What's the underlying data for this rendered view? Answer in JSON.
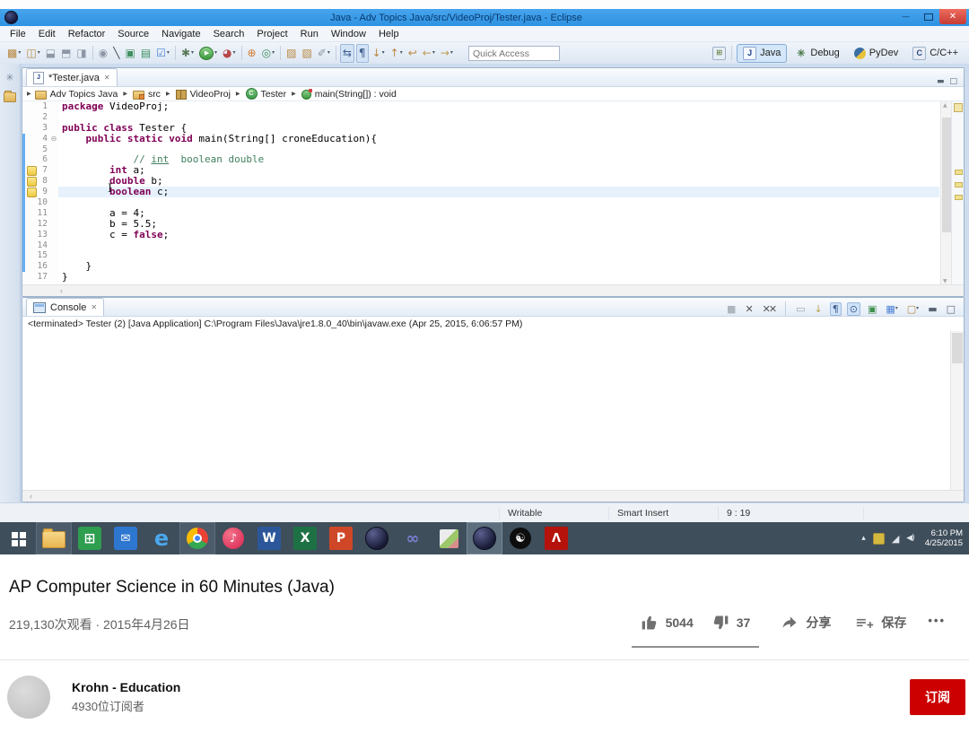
{
  "eclipse": {
    "window_title": "Java - Adv Topics Java/src/VideoProj/Tester.java - Eclipse",
    "menus": [
      "File",
      "Edit",
      "Refactor",
      "Source",
      "Navigate",
      "Search",
      "Project",
      "Run",
      "Window",
      "Help"
    ],
    "quick_access_placeholder": "Quick Access",
    "toolbar_icons": [
      {
        "name": "new-icon",
        "dropdown": true
      },
      {
        "name": "save-all-icon",
        "dropdown": true
      },
      {
        "name": "save-icon"
      },
      {
        "name": "print-icon"
      },
      {
        "name": "export-icon"
      },
      {
        "sep": true
      },
      {
        "name": "search-icon"
      },
      {
        "name": "annotation-icon"
      },
      {
        "name": "new-package-icon"
      },
      {
        "name": "new-class-icon"
      },
      {
        "name": "task-icon",
        "dropdown": true
      },
      {
        "sep": true
      },
      {
        "name": "debug-icon",
        "dropdown": true
      },
      {
        "name": "run-icon",
        "dropdown": true
      },
      {
        "name": "coverage-icon",
        "dropdown": true
      },
      {
        "sep": true
      },
      {
        "name": "junit-icon"
      },
      {
        "name": "gc-icon",
        "dropdown": true
      },
      {
        "sep": true
      },
      {
        "name": "open-type-icon"
      },
      {
        "name": "open-resource-icon"
      },
      {
        "name": "mark-occurrences-icon",
        "dropdown": true
      },
      {
        "sep": true
      },
      {
        "name": "link-editor-icon",
        "boxed": true
      },
      {
        "name": "show-whitespace-icon",
        "boxed": true
      },
      {
        "name": "next-annotation-icon",
        "dropdown": true
      },
      {
        "name": "prev-annotation-icon",
        "dropdown": true
      },
      {
        "name": "last-edit-icon"
      },
      {
        "name": "back-icon",
        "dropdown": true
      },
      {
        "name": "forward-icon",
        "dropdown": true
      }
    ],
    "perspectives": [
      {
        "label": "Java",
        "kind": "java",
        "active": true
      },
      {
        "label": "Debug",
        "kind": "debug",
        "active": false
      },
      {
        "label": "PyDev",
        "kind": "pydev",
        "active": false
      },
      {
        "label": "C/C++",
        "kind": "cpp",
        "active": false
      }
    ],
    "editor": {
      "tab_label": "*Tester.java",
      "breadcrumb": [
        {
          "label": "Adv Topics Java",
          "icon": "java-project-icon"
        },
        {
          "label": "src",
          "icon": "source-folder-icon"
        },
        {
          "label": "VideoProj",
          "icon": "package-icon"
        },
        {
          "label": "Tester",
          "icon": "class-icon"
        },
        {
          "label": "main(String[]) : void",
          "icon": "method-icon"
        }
      ],
      "lines": [
        {
          "n": 1,
          "tokens": [
            [
              "kw",
              "package"
            ],
            [
              "pl",
              " VideoProj;"
            ]
          ]
        },
        {
          "n": 2,
          "tokens": []
        },
        {
          "n": 3,
          "tokens": [
            [
              "kw",
              "public"
            ],
            [
              "pl",
              " "
            ],
            [
              "kw",
              "class"
            ],
            [
              "pl",
              " Tester {"
            ]
          ]
        },
        {
          "n": 4,
          "fold": true,
          "tokens": [
            [
              "pl",
              "    "
            ],
            [
              "kw",
              "public"
            ],
            [
              "pl",
              " "
            ],
            [
              "kw",
              "static"
            ],
            [
              "pl",
              " "
            ],
            [
              "kw",
              "void"
            ],
            [
              "pl",
              " main(String[] croneEducation){"
            ]
          ]
        },
        {
          "n": 5,
          "tokens": []
        },
        {
          "n": 6,
          "tokens": [
            [
              "pl",
              "            "
            ],
            [
              "cm",
              "// "
            ],
            [
              "cmu",
              "int"
            ],
            [
              "cm",
              "  boolean double"
            ]
          ]
        },
        {
          "n": 7,
          "warn": true,
          "tokens": [
            [
              "pl",
              "        "
            ],
            [
              "kw",
              "int"
            ],
            [
              "pl",
              " a;"
            ]
          ]
        },
        {
          "n": 8,
          "warn": true,
          "tokens": [
            [
              "pl",
              "        "
            ],
            [
              "kw",
              "double"
            ],
            [
              "pl",
              " b;"
            ]
          ]
        },
        {
          "n": 9,
          "warn": true,
          "current": true,
          "tokens": [
            [
              "pl",
              "        "
            ],
            [
              "kw",
              "boolean"
            ],
            [
              "pl",
              " c;"
            ]
          ]
        },
        {
          "n": 10,
          "tokens": []
        },
        {
          "n": 11,
          "tokens": [
            [
              "pl",
              "        a = 4;"
            ]
          ]
        },
        {
          "n": 12,
          "tokens": [
            [
              "pl",
              "        b = 5.5;"
            ]
          ]
        },
        {
          "n": 13,
          "tokens": [
            [
              "pl",
              "        c = "
            ],
            [
              "kw",
              "false"
            ],
            [
              "pl",
              ";"
            ]
          ]
        },
        {
          "n": 14,
          "tokens": []
        },
        {
          "n": 15,
          "tokens": []
        },
        {
          "n": 16,
          "tokens": [
            [
              "pl",
              "    }"
            ]
          ]
        },
        {
          "n": 17,
          "tokens": [
            [
              "pl",
              "}"
            ]
          ]
        }
      ],
      "range_start": 4,
      "range_end": 16
    },
    "console": {
      "tab_label": "Console",
      "status_line": "<terminated> Tester (2) [Java Application] C:\\Program Files\\Java\\jre1.8.0_40\\bin\\javaw.exe (Apr 25, 2015, 6:06:57 PM)",
      "icons": [
        {
          "name": "terminate-icon"
        },
        {
          "name": "remove-launch-icon"
        },
        {
          "name": "remove-all-launches-icon"
        },
        {
          "sep": true
        },
        {
          "name": "clear-console-icon"
        },
        {
          "name": "scroll-lock-icon"
        },
        {
          "name": "word-wrap-icon",
          "boxed": true
        },
        {
          "name": "pin-console-icon",
          "boxed": true
        },
        {
          "name": "show-on-stdout-icon"
        },
        {
          "name": "open-console-icon",
          "dropdown": true
        },
        {
          "name": "display-console-icon",
          "dropdown": true
        },
        {
          "name": "minimize-view-icon"
        },
        {
          "name": "maximize-view-icon"
        }
      ]
    },
    "status_bar": {
      "writable": "Writable",
      "insert_mode": "Smart Insert",
      "caret_position": "9 : 19"
    }
  },
  "taskbar": {
    "apps": [
      {
        "name": "start-button",
        "kind": "start"
      },
      {
        "name": "file-explorer-icon",
        "kind": "folder",
        "open": true
      },
      {
        "name": "store-icon",
        "kind": "store"
      },
      {
        "name": "mail-icon",
        "kind": "mail"
      },
      {
        "name": "internet-explorer-icon",
        "kind": "ie"
      },
      {
        "name": "chrome-icon",
        "kind": "chrome",
        "open": true
      },
      {
        "name": "itunes-icon",
        "kind": "itunes"
      },
      {
        "name": "word-icon",
        "kind": "word"
      },
      {
        "name": "excel-icon",
        "kind": "excel"
      },
      {
        "name": "powerpoint-icon",
        "kind": "powerpoint"
      },
      {
        "name": "eclipse-pinned-icon",
        "kind": "eclipse"
      },
      {
        "name": "visual-studio-icon",
        "kind": "vs"
      },
      {
        "name": "photos-icon",
        "kind": "photos"
      },
      {
        "name": "eclipse-active-icon",
        "kind": "eclipse",
        "active": true
      },
      {
        "name": "obs-icon",
        "kind": "obs"
      },
      {
        "name": "adobe-reader-icon",
        "kind": "adobe"
      }
    ],
    "tray_icons": [
      {
        "name": "show-hidden-icons-icon"
      },
      {
        "name": "update-icon"
      },
      {
        "name": "network-icon"
      },
      {
        "name": "volume-icon"
      }
    ],
    "time": "6:10 PM",
    "date": "4/25/2015"
  },
  "video": {
    "title": "AP Computer Science in 60 Minutes (Java)",
    "views_and_date": "219,130次观看 · 2015年4月26日",
    "likes": "5044",
    "dislikes": "37",
    "share_label": "分享",
    "save_label": "保存",
    "more_label": "•••"
  },
  "channel": {
    "name": "Krohn - Education",
    "subscribers": "4930位订阅者",
    "subscribe_label": "订阅"
  }
}
